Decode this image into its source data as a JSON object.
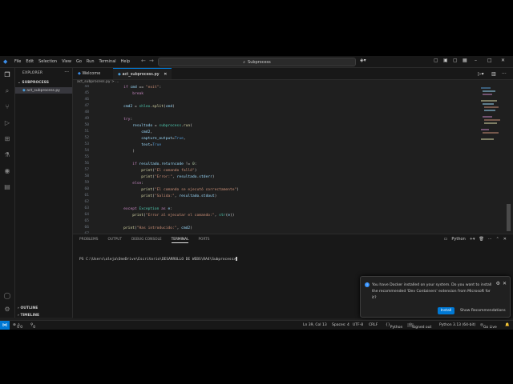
{
  "menu": [
    "File",
    "Edit",
    "Selection",
    "View",
    "Go",
    "Run",
    "Terminal",
    "Help"
  ],
  "search": {
    "text": "Subprocess"
  },
  "explorer": {
    "title": "EXPLORER",
    "folder": "SUBPROCESS",
    "file": "act_subprocess.py",
    "outline": "OUTLINE",
    "timeline": "TIMELINE"
  },
  "tabs": {
    "welcome": "Welcome",
    "active": "act_subprocess.py"
  },
  "breadcrumb": "act_subprocess.py > ...",
  "code": {
    "lines": [
      "44",
      "45",
      "46",
      "47",
      "48",
      "49",
      "50",
      "51",
      "52",
      "53",
      "54",
      "55",
      "56",
      "57",
      "58",
      "59",
      "60",
      "61",
      "62",
      "63",
      "64",
      "65",
      "66",
      "67"
    ]
  },
  "panel": {
    "tabs": [
      "PROBLEMS",
      "OUTPUT",
      "DEBUG CONSOLE",
      "TERMINAL",
      "PORTS"
    ],
    "active_tab": "TERMINAL",
    "shell": "Python",
    "prompt": "PS C:\\Users\\aleja\\OneDrive\\Escritorio\\DESARROLLO DE WEBS\\RA4\\Subprocess>"
  },
  "notification": {
    "message": "You have Docker installed on your system. Do you want to install the recommended 'Dev Containers' extension from Microsoft for it?",
    "install": "Install",
    "show": "Show Recommendations"
  },
  "status": {
    "errors": "0",
    "warnings": "0",
    "ports": "0",
    "position": "Ln 39, Col 13",
    "spaces": "Spaces: 4",
    "encoding": "UTF-8",
    "eol": "CRLF",
    "lang": "Python",
    "signed": "Signed out",
    "interpreter": "Python 3.13 (64-bit)",
    "golive": "Go Live"
  },
  "colors": {
    "accent": "#0078d4",
    "bg": "#1f1f1f",
    "panel": "#181818"
  }
}
